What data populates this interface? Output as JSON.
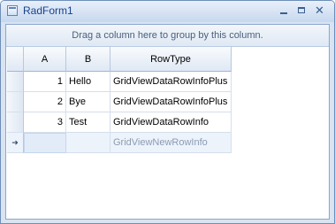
{
  "window": {
    "title": "RadForm1"
  },
  "grid": {
    "group_panel_text": "Drag a column here to group by this column.",
    "columns": [
      "A",
      "B",
      "RowType"
    ],
    "rows": [
      {
        "a": "1",
        "b": "Hello",
        "rowtype": "GridViewDataRowInfoPlus"
      },
      {
        "a": "2",
        "b": "Bye",
        "rowtype": "GridViewDataRowInfoPlus"
      },
      {
        "a": "3",
        "b": "Test",
        "rowtype": "GridViewDataRowInfo"
      }
    ],
    "new_row": {
      "rowtype": "GridViewNewRowInfo",
      "indicator_icon": "arrow-right-icon"
    }
  }
}
